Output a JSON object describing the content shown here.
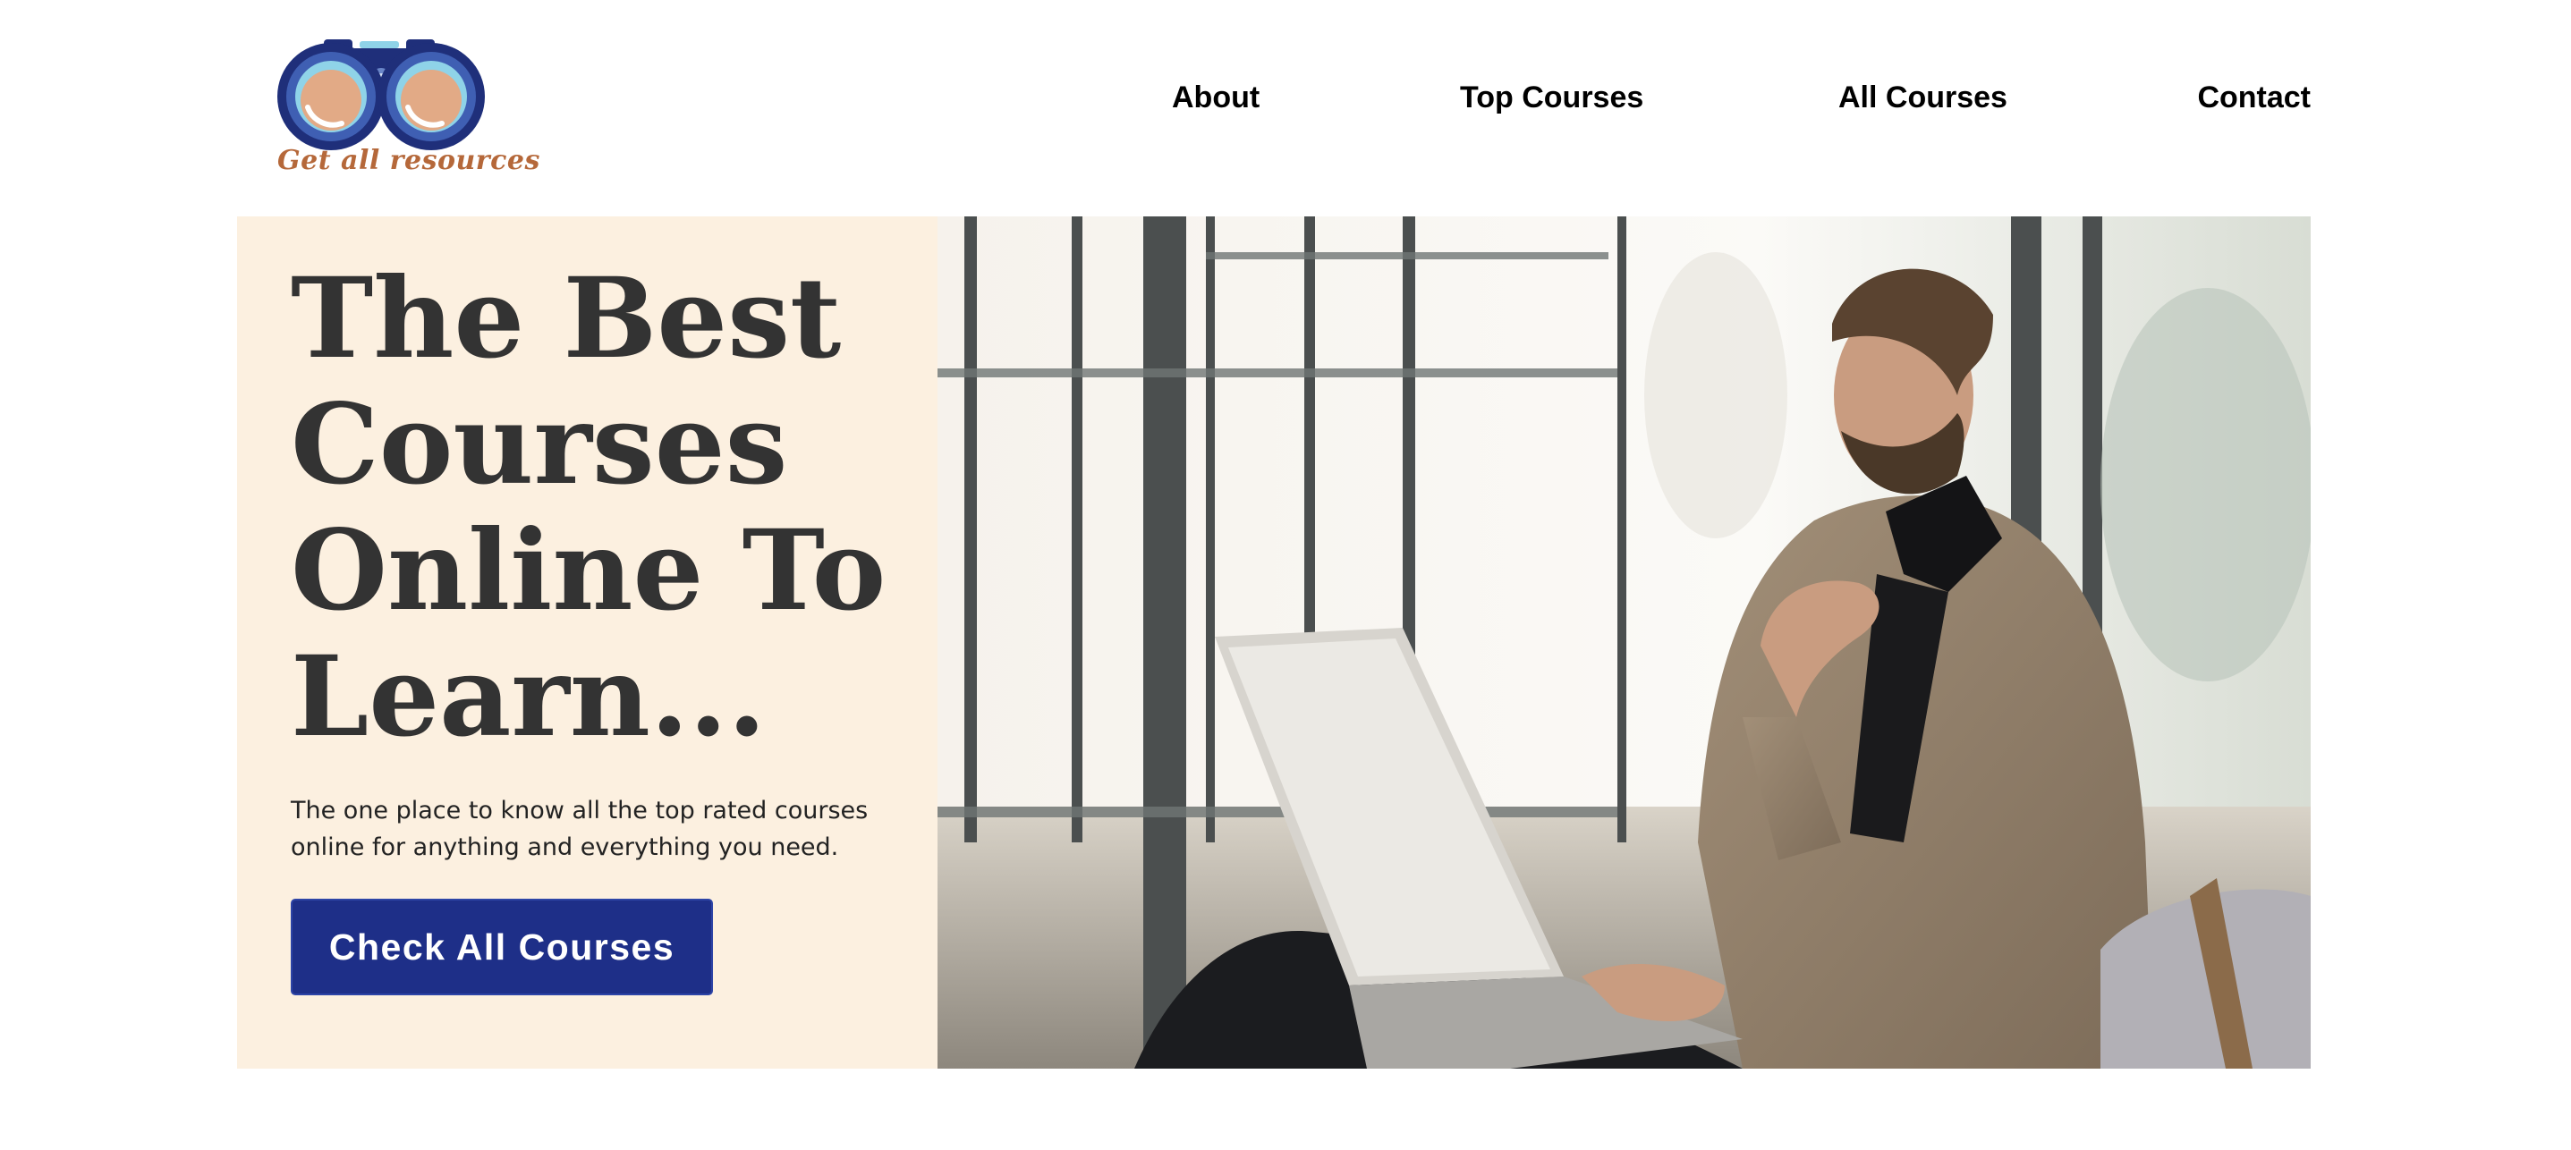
{
  "header": {
    "logo": {
      "tagline": "Get all resources",
      "icon": "binoculars-icon"
    },
    "nav": [
      {
        "label": "About"
      },
      {
        "label": "Top Courses"
      },
      {
        "label": "All Courses"
      },
      {
        "label": "Contact"
      }
    ]
  },
  "hero": {
    "title": "The Best Courses Online To Learn...",
    "subtitle": "The one place to know all the top rated courses online for anything and everything you need.",
    "cta_label": "Check All Courses",
    "photo_subject": "man-working-on-laptop"
  },
  "colors": {
    "hero_panel_bg": "#fcf0e0",
    "title_text": "#333333",
    "cta_bg": "#1e2f88",
    "cta_text": "#ffffff",
    "logo_navy": "#1f2f7a",
    "logo_tagline": "#b5683a"
  }
}
